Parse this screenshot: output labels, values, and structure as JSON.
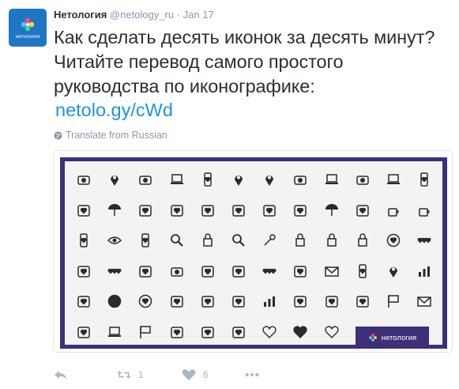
{
  "tweet": {
    "display_name": "Нетология",
    "handle": "@netology_ru",
    "separator": "·",
    "date": "Jan 17",
    "avatar_text": "нетология",
    "text": "Как сделать десять иконок за десять минут? Читайте перевод самого простого руководства по иконографике:",
    "link": "netolo.gy/cWd",
    "translate_label": "Translate from Russian"
  },
  "media": {
    "brand_text": "нетология",
    "frame_color": "#3e2f78",
    "icon_rows": [
      [
        "film-camera-icon",
        "map-pin-icon",
        "film-camera-filled-icon",
        "laptop-photo-icon",
        "phone-icon",
        "map-pin-filled-icon",
        "map-pin-heart-icon",
        "film-camera-icon",
        "laptop-icon",
        "camera-filled-icon",
        "monitor-pen-icon",
        "tablet-icon"
      ],
      [
        "purse-icon",
        "umbrella-icon",
        "heart-person-icon",
        "wallet-icon",
        "purse-outline-icon",
        "ticket-icon",
        "hearts-scatter-icon",
        "hearts-swirl-icon",
        "umbrella-person-icon",
        "heart-balloon-icon",
        "coffee-cup-icon",
        "coffee-cup-heart-icon"
      ],
      [
        "phone-outline-icon",
        "eye-icon",
        "phone-heart-icon",
        "magnifier-icon",
        "lock-icon",
        "magnifier-heart-icon",
        "key-icon",
        "unlock-icon",
        "unlock-outline-icon",
        "lock-heart-icon",
        "diamond-ring-icon",
        "three-hearts-icon"
      ],
      [
        "heart-sound-icon",
        "heart-dots-icon",
        "hands-heart-icon",
        "camera-heart-icon",
        "balloon-heart-icon",
        "purse-heart-icon",
        "heart-outline-dots-icon",
        "hands-heart-filled-icon",
        "envelope-icon",
        "phone-call-heart-icon",
        "heart-pin-icon",
        "heart-bars-icon"
      ],
      [
        "easel-heart-icon",
        "heart-circle-filled-icon",
        "heart-circle-icon",
        "book-heart-icon",
        "ticket-heart-icon",
        "ticket-outline-icon",
        "bar-chart-icon",
        "easel-icon",
        "person-card-icon",
        "chat-heart-icon",
        "flag-heart-icon",
        "mail-heart-icon"
      ],
      [
        "heart-square-icon",
        "monitor-heart-icon",
        "flag-icon",
        "sign-post-icon",
        "plant-heart-icon",
        "heart-plant-icon",
        "heart-outline-icon",
        "heart-filled-icon",
        "heart-thin-icon"
      ]
    ]
  },
  "actions": {
    "reply_label": "",
    "retweet_count": "1",
    "like_count": "6"
  },
  "colors": {
    "link": "#1b95e0",
    "muted": "#8899a6",
    "action": "#aab8c2"
  }
}
